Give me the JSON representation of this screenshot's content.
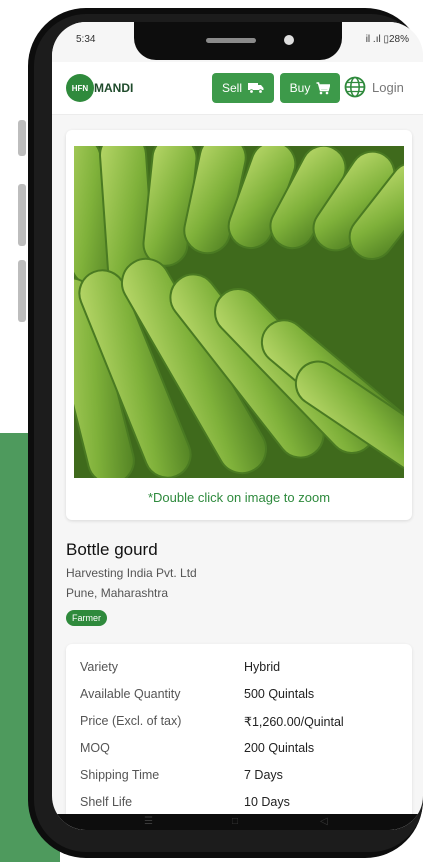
{
  "status": {
    "time": "5:34",
    "signal": "il .ıl ▯28%"
  },
  "header": {
    "logo_mark": "HFN",
    "logo_text": "MANDI",
    "sell_label": "Sell",
    "buy_label": "Buy",
    "login_label": "Login"
  },
  "product": {
    "zoom_hint": "*Double click on image to zoom",
    "name": "Bottle gourd",
    "company": "Harvesting India Pvt. Ltd",
    "location": "Pune, Maharashtra",
    "badge": "Farmer"
  },
  "details": [
    {
      "label": "Variety",
      "value": "Hybrid"
    },
    {
      "label": "Available Quantity",
      "value": "500 Quintals"
    },
    {
      "label": "Price (Excl. of tax)",
      "value": "₹1,260.00/Quintal"
    },
    {
      "label": "MOQ",
      "value": "200 Quintals"
    },
    {
      "label": "Shipping Time",
      "value": "7 Days"
    },
    {
      "label": "Shelf Life",
      "value": "10 Days"
    }
  ],
  "colors": {
    "brand_green": "#3d9a4a",
    "hint_green": "#2e8a3d",
    "band_green": "#4e9a5d"
  },
  "icons": [
    "truck-icon",
    "cart-icon",
    "globe-icon"
  ]
}
